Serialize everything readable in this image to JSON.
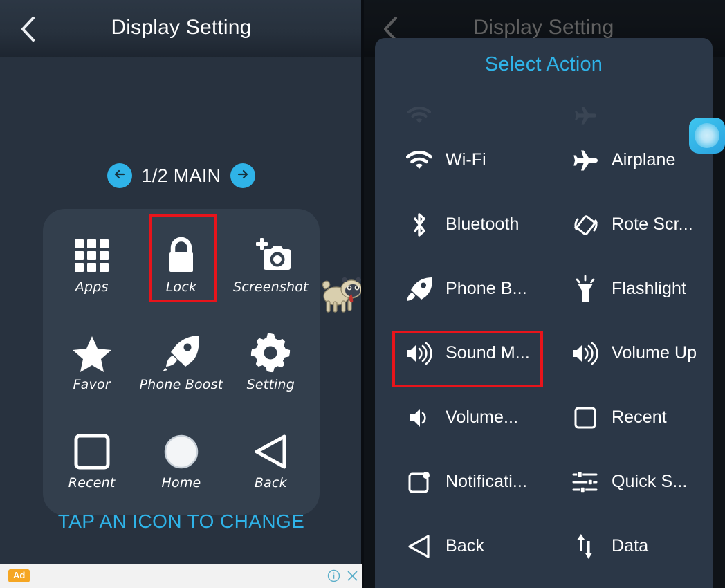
{
  "app": {
    "title": "Display Setting",
    "back_icon": "chevron-left-icon"
  },
  "left_panel": {
    "pager": {
      "prev_icon": "arrow-left-icon",
      "next_icon": "arrow-right-icon",
      "label": "1/2 MAIN"
    },
    "grid": [
      {
        "label": "Apps",
        "icon": "apps-grid-icon"
      },
      {
        "label": "Lock",
        "icon": "padlock-icon"
      },
      {
        "label": "Screenshot",
        "icon": "camera-add-icon"
      },
      {
        "label": "Favor",
        "icon": "star-icon"
      },
      {
        "label": "Phone Boost",
        "icon": "rocket-icon"
      },
      {
        "label": "Setting",
        "icon": "gear-icon"
      },
      {
        "label": "Recent",
        "icon": "square-outline-icon"
      },
      {
        "label": "Home",
        "icon": "circle-outline-icon"
      },
      {
        "label": "Back",
        "icon": "triangle-left-icon"
      }
    ],
    "hint": "TAP AN ICON TO CHANGE",
    "mascot": "pug-dog-mascot"
  },
  "right_panel": {
    "dialog_title": "Select Action",
    "actions": [
      {
        "label": "Wi-Fi",
        "icon": "wifi-icon"
      },
      {
        "label": "Airplane",
        "icon": "airplane-icon"
      },
      {
        "label": "Bluetooth",
        "icon": "bluetooth-icon"
      },
      {
        "label": "Rote Scr...",
        "icon": "rotate-screen-icon"
      },
      {
        "label": "Phone B...",
        "icon": "rocket-icon"
      },
      {
        "label": "Flashlight",
        "icon": "flashlight-icon"
      },
      {
        "label": "Sound M...",
        "icon": "volume-high-icon"
      },
      {
        "label": "Volume Up",
        "icon": "volume-high-icon"
      },
      {
        "label": "Volume...",
        "icon": "volume-low-icon"
      },
      {
        "label": "Recent",
        "icon": "square-outline-icon"
      },
      {
        "label": "Notificati...",
        "icon": "notification-icon"
      },
      {
        "label": "Quick S...",
        "icon": "sliders-icon"
      },
      {
        "label": "Back",
        "icon": "triangle-left-icon"
      },
      {
        "label": "Data",
        "icon": "data-transfer-icon"
      }
    ],
    "float_bubble": "floating-assistant-bubble"
  },
  "ad": {
    "badge": "Ad",
    "info_icon": "info-icon",
    "close_icon": "close-icon"
  },
  "colors": {
    "accent": "#2fb3e8",
    "highlight": "#e8141b",
    "background": "#28323f",
    "card": "#333f4d",
    "dialog": "#2b3747",
    "ad_badge": "#f5a623"
  }
}
